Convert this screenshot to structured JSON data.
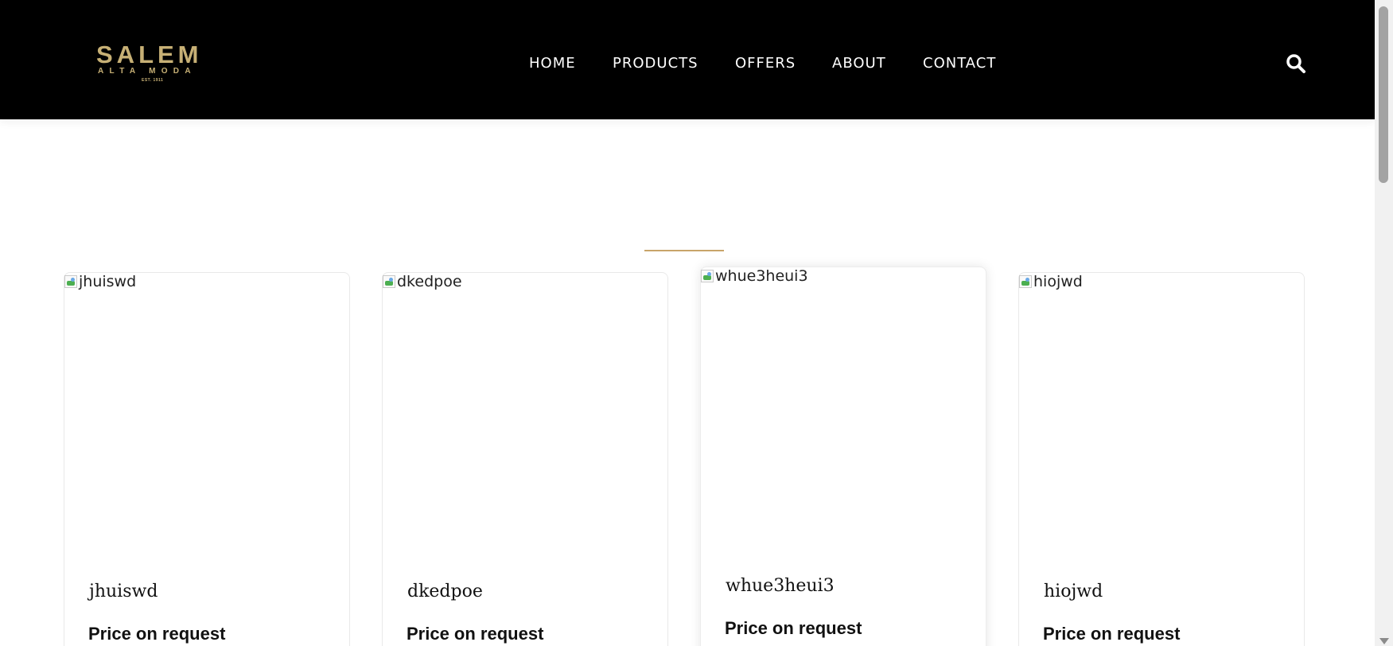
{
  "brand": {
    "name": "SALEM",
    "tagline": "ALTA MODA",
    "established": "EST. 1911",
    "color": "#c7b075"
  },
  "nav": {
    "items": [
      "HOME",
      "PRODUCTS",
      "OFFERS",
      "ABOUT",
      "CONTACT"
    ],
    "search_icon": "search-icon"
  },
  "accent_color": "#c8a46a",
  "products": [
    {
      "image_alt": "jhuiswd",
      "name": "jhuiswd",
      "price": "Price on request"
    },
    {
      "image_alt": "dkedpoe",
      "name": "dkedpoe",
      "price": "Price on request"
    },
    {
      "image_alt": "whue3heui3",
      "name": "whue3heui3",
      "price": "Price on request"
    },
    {
      "image_alt": "hiojwd",
      "name": "hiojwd",
      "price": "Price on request"
    }
  ]
}
